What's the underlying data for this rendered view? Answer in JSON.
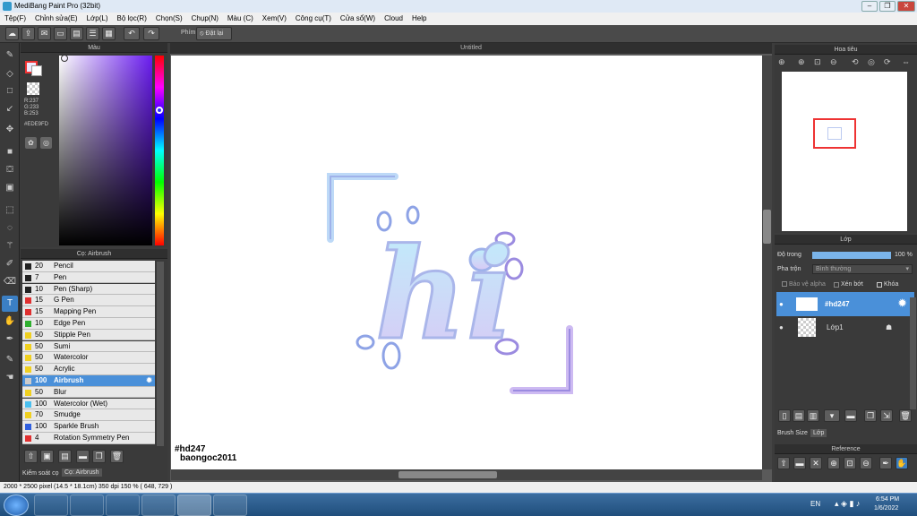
{
  "window": {
    "title": "MediBang Paint Pro (32bit)"
  },
  "menu": [
    "Tệp(F)",
    "Chỉnh sửa(E)",
    "Lớp(L)",
    "Bộ lọc(R)",
    "Chọn(S)",
    "Chụp(N)",
    "Màu (C)",
    "Xem(V)",
    "Công cụ(T)",
    "Cửa sổ(W)",
    "Cloud",
    "Help"
  ],
  "toolbar": {
    "shortcut_label": "Phím",
    "reset_label": "Đặt lại"
  },
  "color_panel": {
    "title": "Màu",
    "r": "R:237",
    "g": "G:233",
    "b": "B:253",
    "hex": "#EDE9FD",
    "fg_color": "#ede9fd"
  },
  "brush_panel": {
    "title": "Cọ: Airbrush",
    "brushes": [
      {
        "size": "20",
        "name": "Pencil",
        "color": "#222222"
      },
      {
        "size": "7",
        "name": "Pen",
        "color": "#222222"
      },
      {
        "size": "10",
        "name": "Pen (Sharp)",
        "color": "#222222"
      },
      {
        "size": "15",
        "name": "G Pen",
        "color": "#e03030"
      },
      {
        "size": "15",
        "name": "Mapping Pen",
        "color": "#e03030"
      },
      {
        "size": "10",
        "name": "Edge Pen",
        "color": "#30b030"
      },
      {
        "size": "50",
        "name": "Stipple Pen",
        "color": "#f0d020"
      },
      {
        "size": "50",
        "name": "Sumi",
        "color": "#f0d020"
      },
      {
        "size": "50",
        "name": "Watercolor",
        "color": "#f0d020"
      },
      {
        "size": "50",
        "name": "Acrylic",
        "color": "#f0d020"
      },
      {
        "size": "100",
        "name": "Airbrush",
        "color": "#cccccc",
        "selected": true
      },
      {
        "size": "50",
        "name": "Blur",
        "color": "#f0d020"
      },
      {
        "size": "100",
        "name": "Watercolor (Wet)",
        "color": "#4ac0f0"
      },
      {
        "size": "70",
        "name": "Smudge",
        "color": "#f0d020"
      },
      {
        "size": "100",
        "name": "Sparkle Brush",
        "color": "#3060e0"
      },
      {
        "size": "4",
        "name": "Rotation Symmetry Pen",
        "color": "#e03030"
      }
    ],
    "bottom_tab_1": "Kiểm soát cọ",
    "bottom_tab_2": "Cọ: Airbrush"
  },
  "canvas": {
    "tab_title": "Untitled",
    "art_text": "hi",
    "signature_line1": "#hd247",
    "signature_line2": "baongoc2011"
  },
  "navigator": {
    "title": "Hoa tiêu"
  },
  "layers": {
    "title": "Lớp",
    "opacity_label": "Độ trong",
    "opacity_value": "100 %",
    "opacity": 1.0,
    "blend_label": "Pha trộn",
    "blend_value": "Bình thường",
    "protect_alpha": "Bảo vệ alpha",
    "clipping": "Xén bớt",
    "lock": "Khóa",
    "items": [
      {
        "name": "#hd247",
        "selected": true
      },
      {
        "name": "Lớp1",
        "selected": false
      }
    ],
    "tab_brush_size": "Brush Size",
    "tab_layer": "Lớp"
  },
  "reference": {
    "title": "Reference"
  },
  "status": {
    "text": "2000 * 2500 pixel  (14.5 * 18.1cm)  350 dpi  150 %  ( 648, 729 )"
  },
  "taskbar": {
    "lang": "EN",
    "time": "6:54 PM",
    "date": "1/6/2022"
  }
}
